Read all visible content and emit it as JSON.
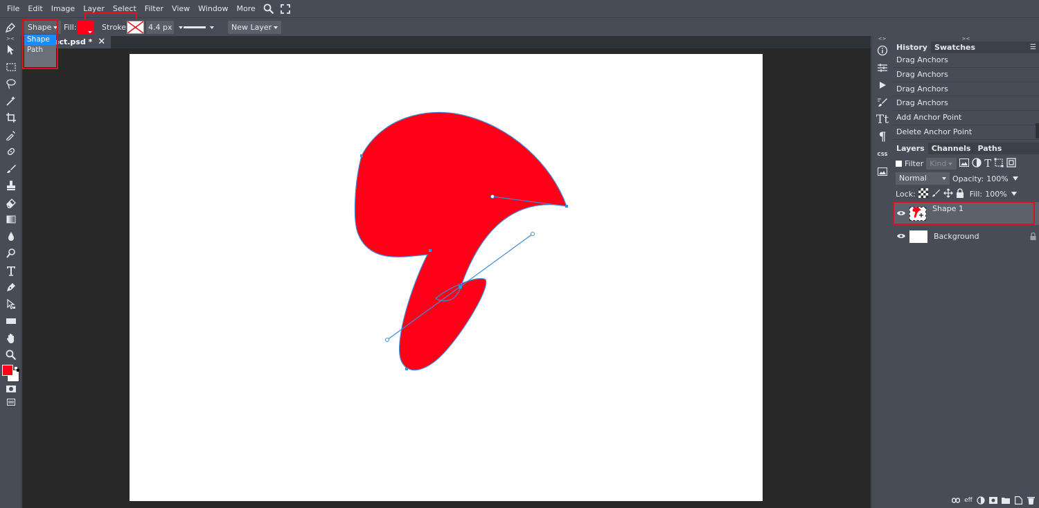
{
  "menubar": {
    "items": [
      "File",
      "Edit",
      "Image",
      "Layer",
      "Select",
      "Filter",
      "View",
      "Window",
      "More"
    ]
  },
  "options": {
    "mode_value": "Shape",
    "mode_options": [
      "Shape",
      "Path"
    ],
    "fill_label": "Fill:",
    "stroke_label": "Stroke:",
    "stroke_width": "4.4 px",
    "new_layer_label": "New Layer",
    "fill_color": "#ff0019"
  },
  "document": {
    "tab_title": "ect.psd *",
    "shape_fill": "#ff0019",
    "path_color": "#3b8ed8"
  },
  "history_panel": {
    "tabs": [
      "History",
      "Swatches"
    ],
    "items": [
      "Drag Anchors",
      "Drag Anchors",
      "Drag Anchors",
      "Drag Anchors",
      "Add Anchor Point",
      "Delete Anchor Point"
    ]
  },
  "layers_panel": {
    "tabs": [
      "Layers",
      "Channels",
      "Paths"
    ],
    "filter_label": "Filter",
    "kind_value": "Kind",
    "blend_mode": "Normal",
    "opacity_label": "Opacity:",
    "opacity_value": "100%",
    "lock_label": "Lock:",
    "fill_label": "Fill:",
    "fill_value": "100%",
    "layers": [
      {
        "name": "Shape 1"
      },
      {
        "name": "Background"
      }
    ]
  },
  "css_label": "CSS"
}
